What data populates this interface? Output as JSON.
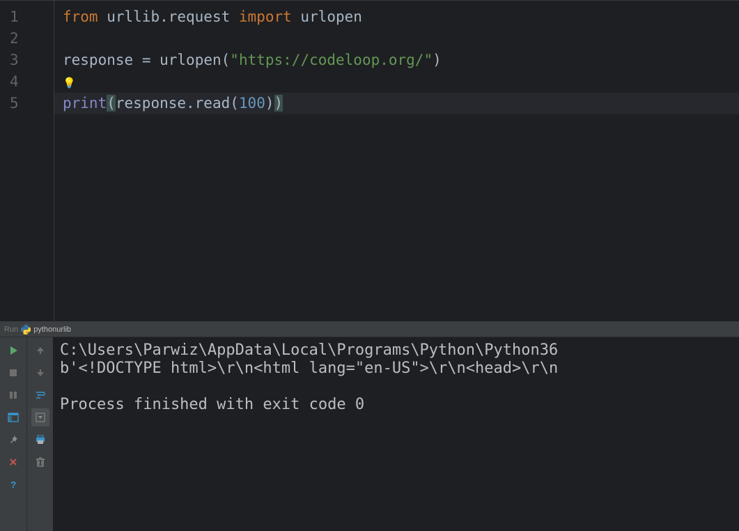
{
  "editor": {
    "lines": [
      "1",
      "2",
      "3",
      "4",
      "5"
    ],
    "code": {
      "l1": {
        "from": "from",
        "mod": "urllib.request",
        "import": "import",
        "name": "urlopen"
      },
      "l3": {
        "lhs": "response",
        "eq": "=",
        "fn": "urlopen",
        "arg": "\"https://codeloop.org/\""
      },
      "l5": {
        "fn": "print",
        "obj": "response.read",
        "num": "100"
      }
    },
    "bulb": "💡"
  },
  "run": {
    "label": "Run",
    "name": "pythonurlib"
  },
  "console": {
    "line1": "C:\\Users\\Parwiz\\AppData\\Local\\Programs\\Python\\Python36",
    "line2": "b'<!DOCTYPE html>\\r\\n<html lang=\"en-US\">\\r\\n<head>\\r\\n",
    "line3": "",
    "line4": "Process finished with exit code 0"
  },
  "icons": {
    "run": "run-icon",
    "stop": "stop-icon",
    "pause": "pause-icon",
    "layout": "layout-icon",
    "pin": "pin-icon",
    "close": "close-icon",
    "help": "help-icon",
    "up": "arrow-up-icon",
    "down": "arrow-down-icon",
    "wrap": "wrap-icon",
    "scroll": "scroll-icon",
    "print": "print-icon",
    "trash": "trash-icon"
  }
}
